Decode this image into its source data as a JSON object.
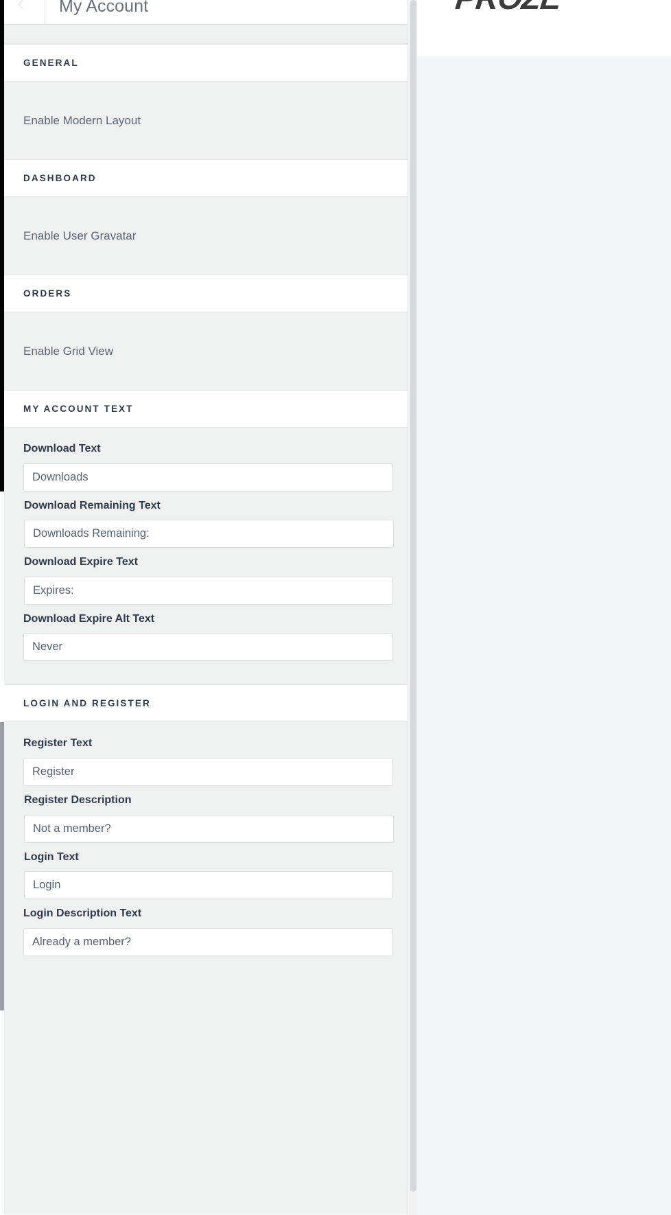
{
  "panel": {
    "title": "My Account",
    "back_icon": "chevron-left-icon"
  },
  "sections": [
    {
      "id": "general",
      "title": "GENERAL",
      "type": "toggles",
      "rows": [
        {
          "label": "Enable Modern Layout"
        }
      ]
    },
    {
      "id": "dashboard",
      "title": "DASHBOARD",
      "type": "toggles",
      "rows": [
        {
          "label": "Enable User Gravatar"
        }
      ]
    },
    {
      "id": "orders",
      "title": "ORDERS",
      "type": "toggles",
      "rows": [
        {
          "label": "Enable Grid View"
        }
      ]
    },
    {
      "id": "my-account-text",
      "title": "MY ACCOUNT TEXT",
      "type": "fields",
      "fields": [
        {
          "label": "Download Text",
          "value": "Downloads",
          "placeholder": "Downloads"
        },
        {
          "label": "Download Remaining Text",
          "value": "Downloads Remaining:",
          "placeholder": "Downloads Remaining:"
        },
        {
          "label": "Download Expire Text",
          "value": "Expires:",
          "placeholder": "Expires:"
        },
        {
          "label": "Download Expire Alt Text",
          "value": "Never",
          "placeholder": "Never"
        }
      ]
    },
    {
      "id": "login-and-register",
      "title": "LOGIN AND REGISTER",
      "type": "fields",
      "fields": [
        {
          "label": "Register Text",
          "value": "Register",
          "placeholder": "Register"
        },
        {
          "label": "Register Description",
          "value": "Not a member?",
          "placeholder": "Not a member?"
        },
        {
          "label": "Login Text",
          "value": "Login",
          "placeholder": "Login"
        },
        {
          "label": "Login Description Text",
          "value": "Already a member?",
          "placeholder": "Already a member?"
        }
      ]
    }
  ],
  "preview": {
    "site_logo": "PROZE"
  },
  "colors": {
    "panel_bg": "#eff0f0",
    "section_bar_bg": "#ffffff",
    "label_text": "#2f3a4a",
    "input_text": "#58626e",
    "toggle_label_text": "#5b6470",
    "title_text": "#6b7077",
    "border": "#e4e6e8",
    "input_border": "#dcdee2",
    "preview_bg": "#f4f5f7",
    "scroll_thumb": "#d7d8da",
    "logo_text": "#3b3b3b"
  }
}
